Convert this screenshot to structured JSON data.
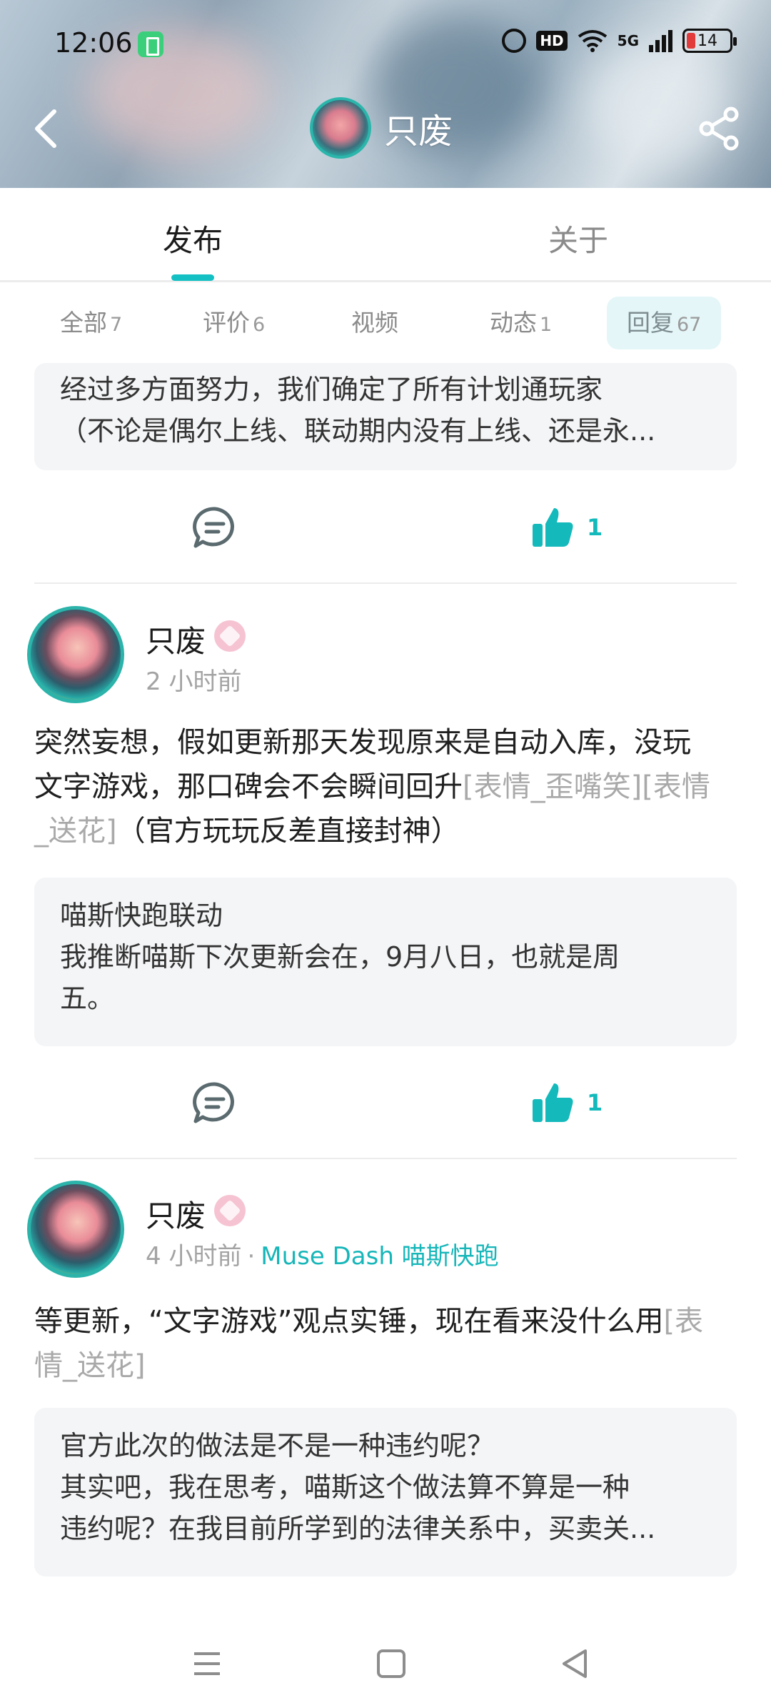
{
  "status_bar": {
    "time": "12:06",
    "hd": "HD",
    "network": "5G",
    "battery": "14"
  },
  "header": {
    "title": "只废"
  },
  "main_tabs": [
    {
      "label": "发布"
    },
    {
      "label": "关于"
    }
  ],
  "sub_tabs": [
    {
      "label": "全部",
      "count": "7"
    },
    {
      "label": "评价",
      "count": "6"
    },
    {
      "label": "视频",
      "count": ""
    },
    {
      "label": "动态",
      "count": "1"
    },
    {
      "label": "回复",
      "count": "67"
    }
  ],
  "feed": {
    "top_quote": {
      "line1": "经过多方面努力，我们确定了所有计划通玩家",
      "line2": "（不论是偶尔上线、联动期内没有上线、还是永..."
    },
    "top_likes": "1",
    "posts": [
      {
        "author": "只废",
        "time": "2 小时前",
        "game": "",
        "body_line1": "突然妄想，假如更新那天发现原来是自动入库，没玩",
        "body_line2_a": "文字游戏，那口碑会不会瞬间回升",
        "body_line2_b": "[表情_歪嘴笑][表情",
        "body_line3_a": "_送花]",
        "body_line3_b": "（官方玩玩反差直接封神）",
        "quote_title": "喵斯快跑联动",
        "quote_line1": "我推断喵斯下次更新会在，9月八日，也就是周",
        "quote_line2": "五。",
        "likes": "1"
      },
      {
        "author": "只废",
        "time": "4 小时前",
        "game": "Muse Dash 喵斯快跑",
        "body_line1_a": "等更新，“文字游戏”观点实锤，现在看来没什么用",
        "body_line1_b": "[表",
        "body_line2": "情_送花]",
        "quote_title": "官方此次的做法是不是一种违约呢？",
        "quote_line1": "其实吧，我在思考，喵斯这个做法算不算是一种",
        "quote_line2": "违约呢？在我目前所学到的法律关系中，买卖关..."
      }
    ]
  }
}
